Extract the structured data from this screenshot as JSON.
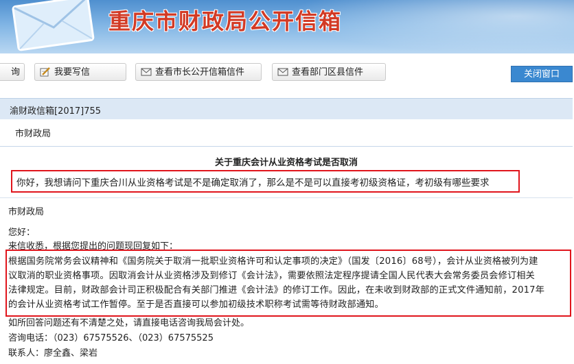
{
  "header": {
    "title": "重庆市财政局公开信箱"
  },
  "toolbar": {
    "left_partial_label": "询",
    "write_letter": "我要写信",
    "mayor_letters": "查看市长公开信箱信件",
    "dept_letters": "查看部门区县信件",
    "close": "关闭窗口"
  },
  "letter": {
    "number": "渝财政信箱[2017]755",
    "recipient": "市财政局",
    "subject": "关于重庆会计从业资格考试是否取消",
    "question": "你好，我想请问下重庆合川从业资格考试是不是确定取消了，那么是不是可以直接考初级资格证，考初级有哪些要求"
  },
  "reply": {
    "from": "市财政局",
    "greeting": "您好：",
    "intro": "来信收悉，根据您提出的问题现回复如下：",
    "lines": [
      "根据国务院常务会议精神和《国务院关于取消一批职业资格许可和认定事项的决定》（国发〔2016〕68号），会计从业资格被列为建",
      "议取消的职业资格事项。因取消会计从业资格涉及到修订《会计法》，需要依照法定程序提请全国人民代表大会常务委员会修订相关",
      "法律规定。目前，财政部会计司正积极配合有关部门推进《会计法》的修订工作。因此，在未收到财政部的正式文件通知前，2017年",
      "的会计从业资格考试工作暂停。至于是否直接可以参加初级技术职称考试需等待财政部通知。"
    ],
    "closing": "如所回答问题还有不清楚之处，请直接电话咨询我局会计处。",
    "phone": "咨询电话：（023）67575526、（023）67575525",
    "contact": "联系人：廖全鑫、梁岩"
  }
}
